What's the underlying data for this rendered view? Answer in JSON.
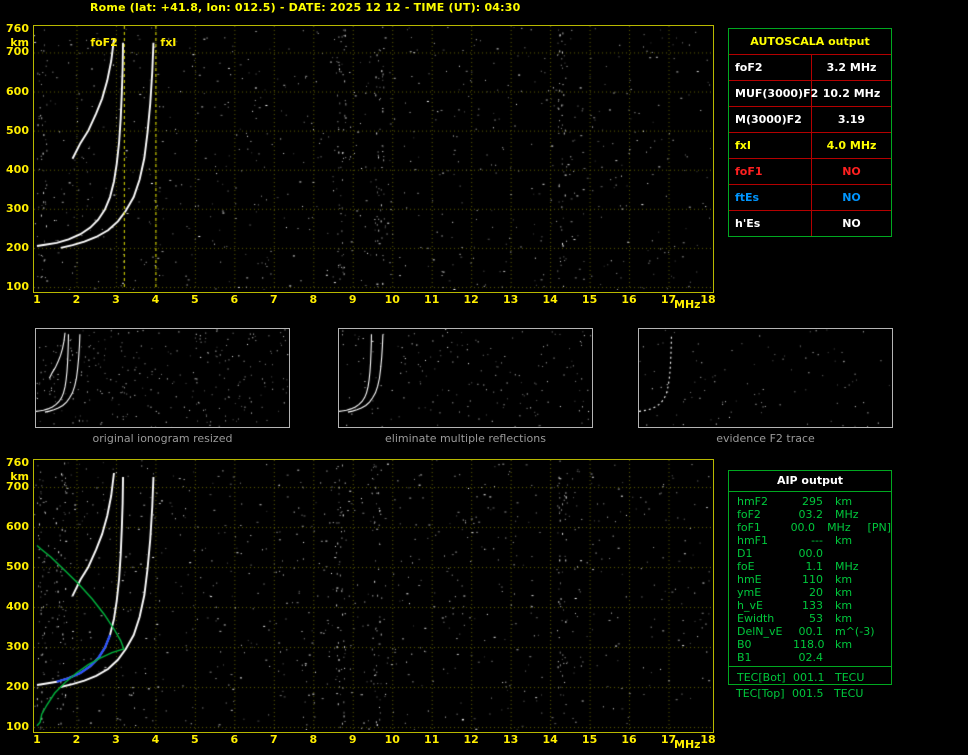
{
  "header": {
    "title": "Rome (lat: +41.8, lon: 012.5) - DATE: 2025 12 12 - TIME (UT): 04:30"
  },
  "colors": {
    "background": "#000000",
    "title": "#ffff00",
    "plot_border": "#b8b800",
    "grid": "#5e5e00",
    "axis_label": "#ffee00",
    "trace": "#ffffff",
    "marker_line": "#e0e000",
    "profile_green": "#00b43c",
    "fitted_blue": "#2850ff",
    "table_green": "#00a820",
    "table_red_line": "#b40000",
    "aip_text_green": "#00c83c",
    "caption_gray": "#9a9a9a"
  },
  "autoscala": {
    "title": "AUTOSCALA output",
    "rows": [
      {
        "label": "foF2",
        "value": "3.2 MHz",
        "color": "#ffffff"
      },
      {
        "label": "MUF(3000)F2",
        "value": "10.2 MHz",
        "color": "#ffffff"
      },
      {
        "label": "M(3000)F2",
        "value": "3.19",
        "color": "#ffffff"
      },
      {
        "label": "fxI",
        "value": "4.0 MHz",
        "color": "#ffff00"
      },
      {
        "label": "foF1",
        "value": "NO",
        "color": "#ff2020"
      },
      {
        "label": "ftEs",
        "value": "NO",
        "color": "#0096ff"
      },
      {
        "label": "h'Es",
        "value": "NO",
        "color": "#ffffff"
      }
    ]
  },
  "thumbnails": [
    {
      "caption": "original ionogram resized"
    },
    {
      "caption": "eliminate multiple reflections"
    },
    {
      "caption": "evidence F2 trace"
    }
  ],
  "aip": {
    "title": "AIP output",
    "rows": [
      {
        "name": "hmF2",
        "value": "295",
        "unit": "km",
        "note": ""
      },
      {
        "name": "foF2",
        "value": "03.2",
        "unit": "MHz",
        "note": ""
      },
      {
        "name": "foF1",
        "value": "00.0",
        "unit": "MHz",
        "note": "[PN]"
      },
      {
        "name": "hmF1",
        "value": "---",
        "unit": "km",
        "note": ""
      },
      {
        "name": "D1",
        "value": "00.0",
        "unit": "",
        "note": ""
      },
      {
        "name": "foE",
        "value": "1.1",
        "unit": "MHz",
        "note": ""
      },
      {
        "name": "hmE",
        "value": "110",
        "unit": "km",
        "note": ""
      },
      {
        "name": "ymE",
        "value": "20",
        "unit": "km",
        "note": ""
      },
      {
        "name": "h_vE",
        "value": "133",
        "unit": "km",
        "note": ""
      },
      {
        "name": "Ewidth",
        "value": "53",
        "unit": "km",
        "note": ""
      },
      {
        "name": "DelN_vE",
        "value": "00.1",
        "unit": "m^(-3)",
        "note": ""
      },
      {
        "name": "B0",
        "value": "118.0",
        "unit": "km",
        "note": ""
      },
      {
        "name": "B1",
        "value": "02.4",
        "unit": "",
        "note": ""
      }
    ],
    "tec_rows": [
      {
        "name": "TEC[Bot]",
        "value": "001.1",
        "unit": "TECU",
        "note": ""
      },
      {
        "name": "TEC[Top]",
        "value": "001.5",
        "unit": "TECU",
        "note": ""
      }
    ]
  },
  "chart_data": [
    {
      "type": "scatter",
      "title": "ionogram with AUTOSCALA scaled characteristics",
      "xlabel": "MHz",
      "ylabel": "km",
      "xlim": [
        1,
        18
      ],
      "ylim": [
        100,
        760
      ],
      "x_ticks": [
        1,
        2,
        3,
        4,
        5,
        6,
        7,
        8,
        9,
        10,
        11,
        12,
        13,
        14,
        15,
        16,
        17,
        18
      ],
      "y_ticks": [
        760,
        700,
        600,
        500,
        400,
        300,
        200,
        100
      ],
      "grid": "dotted",
      "legend": "none",
      "markers": [
        {
          "label": "foF2",
          "x": 3.2,
          "side": "left"
        },
        {
          "label": "fxI",
          "x": 4.0,
          "side": "right"
        }
      ],
      "noise_bands_mhz": [
        1.12,
        8.7,
        9.65,
        14.3
      ],
      "series": [
        {
          "name": "O-trace",
          "color": "#ffffff",
          "points": [
            [
              1.0,
              205
            ],
            [
              1.2,
              208
            ],
            [
              1.5,
              213
            ],
            [
              1.8,
              222
            ],
            [
              2.1,
              235
            ],
            [
              2.35,
              252
            ],
            [
              2.55,
              272
            ],
            [
              2.72,
              298
            ],
            [
              2.85,
              330
            ],
            [
              2.95,
              370
            ],
            [
              3.02,
              415
            ],
            [
              3.08,
              470
            ],
            [
              3.12,
              530
            ],
            [
              3.15,
              600
            ],
            [
              3.17,
              660
            ],
            [
              3.18,
              725
            ]
          ]
        },
        {
          "name": "X-trace",
          "color": "#ffffff",
          "points": [
            [
              1.6,
              200
            ],
            [
              1.9,
              207
            ],
            [
              2.2,
              216
            ],
            [
              2.5,
              228
            ],
            [
              2.8,
              245
            ],
            [
              3.05,
              268
            ],
            [
              3.25,
              295
            ],
            [
              3.45,
              330
            ],
            [
              3.6,
              375
            ],
            [
              3.72,
              430
            ],
            [
              3.8,
              495
            ],
            [
              3.87,
              570
            ],
            [
              3.92,
              650
            ],
            [
              3.95,
              725
            ]
          ]
        },
        {
          "name": "second-hop F trace",
          "color": "#ffffff",
          "points": [
            [
              1.9,
              428
            ],
            [
              2.1,
              468
            ],
            [
              2.3,
              500
            ],
            [
              2.5,
              544
            ],
            [
              2.65,
              582
            ],
            [
              2.78,
              628
            ],
            [
              2.88,
              678
            ],
            [
              2.95,
              735
            ]
          ]
        }
      ]
    },
    {
      "type": "scatter",
      "title": "ionogram with AIP restored electron density profile",
      "xlabel": "MHz",
      "ylabel": "km",
      "xlim": [
        1,
        18
      ],
      "ylim": [
        100,
        760
      ],
      "x_ticks": [
        1,
        2,
        3,
        4,
        5,
        6,
        7,
        8,
        9,
        10,
        11,
        12,
        13,
        14,
        15,
        16,
        17,
        18
      ],
      "y_ticks": [
        760,
        700,
        600,
        500,
        400,
        300,
        200,
        100
      ],
      "grid": "dotted",
      "legend": "none",
      "markers": [],
      "noise_bands_mhz": [
        1.12,
        1.6,
        8.7,
        9.6,
        14.3
      ],
      "series": [
        {
          "name": "O-trace",
          "color": "#ffffff",
          "points": [
            [
              1.0,
              205
            ],
            [
              1.2,
              208
            ],
            [
              1.5,
              213
            ],
            [
              1.8,
              222
            ],
            [
              2.1,
              235
            ],
            [
              2.35,
              252
            ],
            [
              2.55,
              272
            ],
            [
              2.72,
              298
            ],
            [
              2.85,
              330
            ],
            [
              2.95,
              370
            ],
            [
              3.02,
              415
            ],
            [
              3.08,
              470
            ],
            [
              3.12,
              530
            ],
            [
              3.15,
              600
            ],
            [
              3.17,
              660
            ],
            [
              3.18,
              725
            ]
          ]
        },
        {
          "name": "X-trace",
          "color": "#ffffff",
          "points": [
            [
              1.6,
              200
            ],
            [
              1.9,
              207
            ],
            [
              2.2,
              216
            ],
            [
              2.5,
              228
            ],
            [
              2.8,
              245
            ],
            [
              3.05,
              268
            ],
            [
              3.25,
              295
            ],
            [
              3.45,
              330
            ],
            [
              3.6,
              375
            ],
            [
              3.72,
              430
            ],
            [
              3.8,
              495
            ],
            [
              3.87,
              570
            ],
            [
              3.92,
              650
            ],
            [
              3.95,
              725
            ]
          ]
        },
        {
          "name": "second-hop F trace",
          "color": "#ffffff",
          "points": [
            [
              1.9,
              428
            ],
            [
              2.1,
              468
            ],
            [
              2.3,
              500
            ],
            [
              2.5,
              544
            ],
            [
              2.65,
              582
            ],
            [
              2.78,
              628
            ],
            [
              2.88,
              678
            ],
            [
              2.95,
              735
            ]
          ]
        },
        {
          "name": "fitted F2 trace",
          "color": "#2850ff",
          "width": 2.2,
          "points": [
            [
              1.5,
              213
            ],
            [
              1.8,
              222
            ],
            [
              2.1,
              235
            ],
            [
              2.35,
              252
            ],
            [
              2.55,
              272
            ],
            [
              2.72,
              298
            ],
            [
              2.85,
              330
            ]
          ]
        },
        {
          "name": "electron density profile",
          "color": "#00b43c",
          "width": 1.4,
          "points": [
            [
              1.0,
              103
            ],
            [
              1.08,
              112
            ],
            [
              1.12,
              132
            ],
            [
              1.25,
              155
            ],
            [
              1.45,
              185
            ],
            [
              1.7,
              210
            ],
            [
              2.0,
              235
            ],
            [
              2.3,
              256
            ],
            [
              2.6,
              272
            ],
            [
              2.9,
              286
            ],
            [
              3.1,
              292
            ],
            [
              3.2,
              295
            ],
            [
              3.12,
              316
            ],
            [
              2.95,
              345
            ],
            [
              2.7,
              382
            ],
            [
              2.4,
              420
            ],
            [
              2.05,
              458
            ],
            [
              1.7,
              492
            ],
            [
              1.35,
              525
            ],
            [
              1.1,
              545
            ],
            [
              1.0,
              554
            ]
          ]
        }
      ]
    }
  ]
}
